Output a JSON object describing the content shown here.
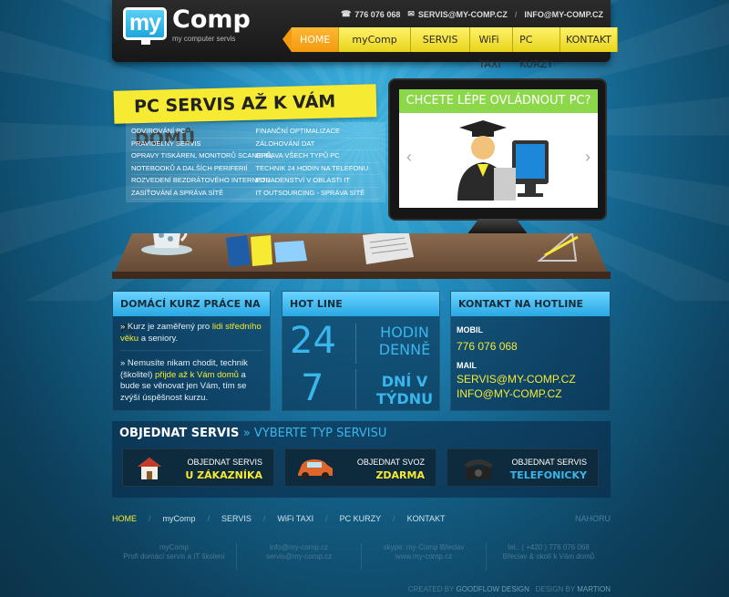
{
  "header": {
    "logo_box": "my",
    "logo_word": "Comp",
    "logo_sub": "my computer servis",
    "phone": "776 076 068",
    "email1": "SERVIS@MY-COMP.CZ",
    "email2": "INFO@MY-COMP.CZ"
  },
  "nav": [
    "HOME",
    "myComp",
    "SERVIS",
    "WiFi TAXI",
    "PC KURZY",
    "KONTAKT"
  ],
  "hero": {
    "title": "PC SERVIS AŽ K VÁM DOMŮ",
    "col1": [
      "ODVIROVÁNÍ PC",
      "PRAVIDELNÝ SERVIS",
      "OPRAVY TISKÁREN, MONITORŮ SCANERŮ,",
      "NOTEBOOKŮ A DALŠÍCH PERIFERIÍ",
      "ROZVEDENÍ BEZDRÁTOVÉHO INTERNETU",
      "ZASÍŤOVÁNÍ A SPRÁVA SÍTĚ"
    ],
    "col2": [
      "FINANČNÍ OPTIMALIZACE",
      "ZÁLOHOVÁNÍ DAT",
      "OPRAVA VŠECH TYPŮ PC",
      "TECHNIK 24 HODIN NA TELEFONU",
      "PORADENSTVÍ V OBLASTI IT",
      "IT OUTSOURCING - SPRÁVA SÍTĚ"
    ],
    "screen_title": "CHCETE LÉPE OVLÁDNOUT PC?"
  },
  "box1": {
    "title": "DOMÁCÍ KURZ PRÁCE NA PC",
    "p1_pre": "» Kurz je zaměřený pro ",
    "p1_hl": "lidi středního věku",
    "p1_post": " a seniory.",
    "p2_pre": "» Nemusíte nikam chodit, technik (školitel) ",
    "p2_hl": "přijde až k Vám domů",
    "p2_post": " a bude se věnovat jen Vám, tím se zvýší úspěšnost kurzu."
  },
  "box2": {
    "title": "HOT LINE",
    "num1": "24",
    "text1": "HODIN DENNĚ",
    "num2": "7",
    "text2": "DNÍ V TÝDNU"
  },
  "box3": {
    "title": "KONTAKT NA HOTLINE",
    "mobil_label": "MOBIL",
    "mobil": "776 076 068",
    "mail_label": "MAIL",
    "mail1": "SERVIS@MY-COMP.CZ",
    "mail2": "INFO@MY-COMP.CZ"
  },
  "order": {
    "title": "OBJEDNAT SERVIS",
    "subtitle": "» VYBERTE TYP SERVISU",
    "buttons": [
      {
        "line1": "OBJEDNAT SERVIS",
        "line2": "U ZÁKAZNÍKA",
        "icon": "house-icon"
      },
      {
        "line1": "OBJEDNAT SVOZ",
        "line2": "ZDARMA",
        "icon": "car-icon"
      },
      {
        "line1": "OBJEDNAT SERVIS",
        "line2": "TELEFONICKY",
        "icon": "telephone-icon"
      }
    ]
  },
  "footer": {
    "nav": [
      "HOME",
      "myComp",
      "SERVIS",
      "WiFi TAXI",
      "PC KURZY",
      "KONTAKT"
    ],
    "top": "NAHORU",
    "cols": [
      [
        "myComp",
        "Profi domácí servis a IT školení"
      ],
      [
        "info@my-comp.cz",
        "servis@my-comp.cz"
      ],
      [
        "skype: my-Comp Břeclav",
        "www.my-comp.cz"
      ],
      [
        "tel.: ( +420 ) 776 076 068",
        "Břeclav & okolí k Vám domů"
      ]
    ],
    "credit1_pre": "CREATED BY",
    "credit1": "GOODFLOW DESIGN",
    "credit2_pre": "DESIGN BY",
    "credit2": "MARTION"
  }
}
